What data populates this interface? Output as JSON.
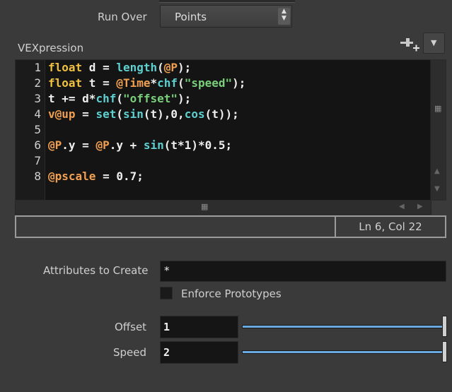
{
  "run_over": {
    "label": "Run Over",
    "value": "Points"
  },
  "vexpression": {
    "label": "VEXpression",
    "lines": [
      {
        "n": "1",
        "segs": [
          {
            "t": "float",
            "c": "#f0c040"
          },
          {
            "t": " d = ",
            "c": "#eeeeee"
          },
          {
            "t": "length",
            "c": "#5fd0d0"
          },
          {
            "t": "(",
            "c": "#eeeeee"
          },
          {
            "t": "@P",
            "c": "#f0a050"
          },
          {
            "t": ");",
            "c": "#eeeeee"
          }
        ]
      },
      {
        "n": "2",
        "segs": [
          {
            "t": "float",
            "c": "#f0c040"
          },
          {
            "t": " t = ",
            "c": "#eeeeee"
          },
          {
            "t": "@Time",
            "c": "#f0a050"
          },
          {
            "t": "*",
            "c": "#eeeeee"
          },
          {
            "t": "chf",
            "c": "#5fd0d0"
          },
          {
            "t": "(",
            "c": "#eeeeee"
          },
          {
            "t": "\"speed\"",
            "c": "#7ad07a"
          },
          {
            "t": ");",
            "c": "#eeeeee"
          }
        ]
      },
      {
        "n": "3",
        "segs": [
          {
            "t": "t += d*",
            "c": "#eeeeee"
          },
          {
            "t": "chf",
            "c": "#5fd0d0"
          },
          {
            "t": "(",
            "c": "#eeeeee"
          },
          {
            "t": "\"offset\"",
            "c": "#7ad07a"
          },
          {
            "t": ");",
            "c": "#eeeeee"
          }
        ]
      },
      {
        "n": "4",
        "segs": [
          {
            "t": "v@up",
            "c": "#f0a050"
          },
          {
            "t": " = ",
            "c": "#eeeeee"
          },
          {
            "t": "set",
            "c": "#5fd0d0"
          },
          {
            "t": "(",
            "c": "#eeeeee"
          },
          {
            "t": "sin",
            "c": "#5fd0d0"
          },
          {
            "t": "(t),0,",
            "c": "#eeeeee"
          },
          {
            "t": "cos",
            "c": "#5fd0d0"
          },
          {
            "t": "(t));",
            "c": "#eeeeee"
          }
        ]
      },
      {
        "n": "5",
        "segs": []
      },
      {
        "n": "6",
        "segs": [
          {
            "t": "@P",
            "c": "#f0a050"
          },
          {
            "t": ".y = ",
            "c": "#eeeeee"
          },
          {
            "t": "@P",
            "c": "#f0a050"
          },
          {
            "t": ".y + ",
            "c": "#eeeeee"
          },
          {
            "t": "sin",
            "c": "#5fd0d0"
          },
          {
            "t": "(t*1)*0.5;",
            "c": "#eeeeee"
          }
        ]
      },
      {
        "n": "7",
        "segs": []
      },
      {
        "n": "8",
        "segs": [
          {
            "t": "@pscale",
            "c": "#f0a050"
          },
          {
            "t": " = 0.7;",
            "c": "#eeeeee"
          }
        ]
      }
    ]
  },
  "status": {
    "cursor": "Ln 6, Col 22"
  },
  "attributes_to_create": {
    "label": "Attributes to Create",
    "value": "*"
  },
  "enforce_prototypes": {
    "label": "Enforce Prototypes",
    "checked": false
  },
  "offset": {
    "label": "Offset",
    "value": "1",
    "slider_fraction": 1.0
  },
  "speed": {
    "label": "Speed",
    "value": "2",
    "slider_fraction": 1.0
  },
  "icons": {
    "run_over_arrows": "up-down-arrows-icon",
    "add_param": "add-parameter-icon",
    "menu": "dropdown-arrow-icon"
  }
}
